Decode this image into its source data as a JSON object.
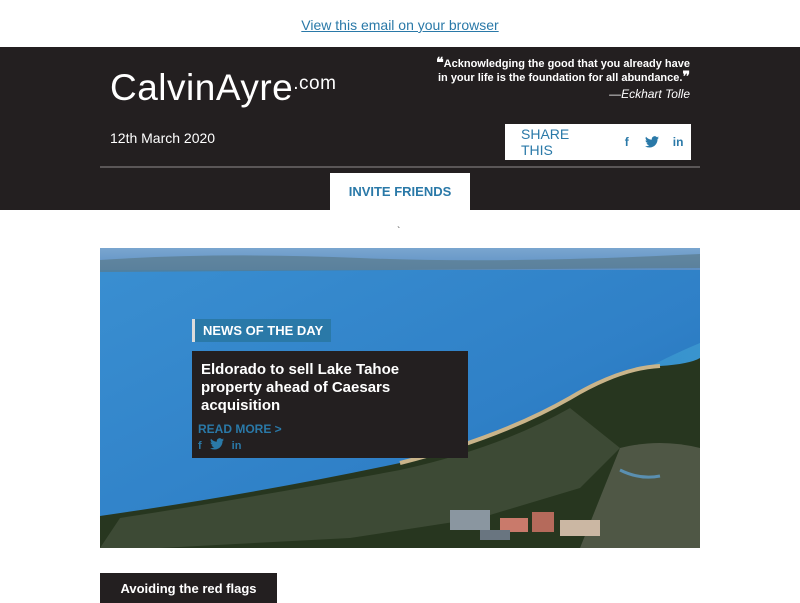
{
  "top_link": "View this email on your browser",
  "header": {
    "logo_main": "CalvinAyre",
    "logo_suffix": ".com",
    "quote_text": "Acknowledging the good that you already have in your life is the foundation for all abundance.",
    "quote_author": "—Eckhart Tolle",
    "date": "12th March 2020",
    "share_label": "SHARE THIS",
    "invite_label": "INVITE FRIENDS",
    "share_icons": {
      "facebook": "f",
      "twitter": "twitter-bird",
      "linkedin": "in"
    }
  },
  "separator_mark": "`",
  "hero": {
    "badge": "NEWS OF THE DAY",
    "title": "Eldorado to sell Lake Tahoe property ahead of Caesars acquisition",
    "read_more": "READ MORE >",
    "icons": {
      "facebook": "f",
      "twitter": "twitter-bird",
      "linkedin": "in"
    }
  },
  "next_section": "Avoiding the red flags",
  "colors": {
    "accent": "#2a79a8",
    "dark": "#231f20",
    "white": "#ffffff"
  }
}
